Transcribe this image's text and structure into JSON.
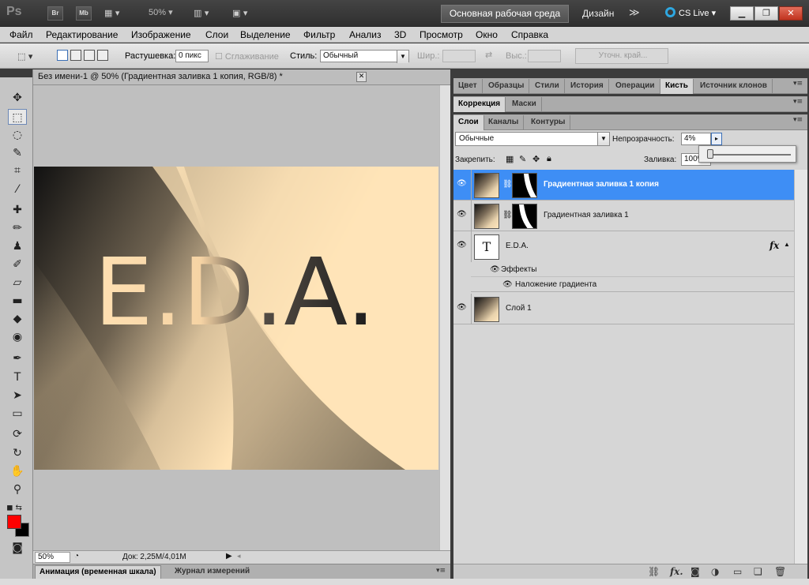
{
  "app": {
    "logo": "Ps",
    "bridge": "Br",
    "minibridge": "Mb",
    "zoom_display": "50%",
    "workspace_active": "Основная рабочая среда",
    "workspace_design": "Дизайн",
    "cslive": "CS Live"
  },
  "menu": [
    "Файл",
    "Редактирование",
    "Изображение",
    "Слои",
    "Выделение",
    "Фильтр",
    "Анализ",
    "3D",
    "Просмотр",
    "Окно",
    "Справка"
  ],
  "options": {
    "feather_label": "Растушевка:",
    "feather_value": "0 пикс",
    "antialias_label": "Сглаживание",
    "style_label": "Стиль:",
    "style_value": "Обычный",
    "width_label": "Шир.:",
    "height_label": "Выс.:",
    "refine_edge": "Уточн. край..."
  },
  "document": {
    "tab_title": "Без имени-1 @ 50% (Градиентная заливка 1 копия, RGB/8) *",
    "canvas_text": "E.D.A.",
    "zoom": "50%",
    "doc_info": "Док: 2,25M/4,01M"
  },
  "bottom_tabs": [
    "Анимация (временная шкала)",
    "Журнал измерений"
  ],
  "panels": {
    "row1_tabs": [
      "Цвет",
      "Образцы",
      "Стили",
      "История",
      "Операции",
      "Кисть",
      "Источник клонов"
    ],
    "row1_active": "Кисть",
    "row2_tabs": [
      "Коррекция",
      "Маски"
    ],
    "row3_tabs": [
      "Слои",
      "Каналы",
      "Контуры"
    ]
  },
  "layers_panel": {
    "blend_mode": "Обычные",
    "opacity_label": "Непрозрачность:",
    "opacity_value": "4%",
    "lock_label": "Закрепить:",
    "fill_label": "Заливка:",
    "fill_value": "100%",
    "layers": [
      {
        "name": "Градиентная заливка 1 копия",
        "selected": true
      },
      {
        "name": "Градиентная заливка 1",
        "selected": false
      },
      {
        "name": "E.D.A.",
        "selected": false,
        "thumb_letter": "T"
      },
      {
        "name": "Слой 1",
        "selected": false
      }
    ],
    "effects_label": "Эффекты",
    "effect_name": "Наложение градиента",
    "fx_badge": "fx"
  },
  "colors": {
    "foreground": "#ff0000",
    "background": "#000000",
    "selection": "#3e8ef5",
    "workspace_accent": "#2ea7e0"
  },
  "icons": {
    "layer_footer": [
      "link-icon",
      "fx-icon",
      "mask-icon",
      "adjustment-icon",
      "folder-icon",
      "new-layer-icon",
      "trash-icon"
    ]
  }
}
